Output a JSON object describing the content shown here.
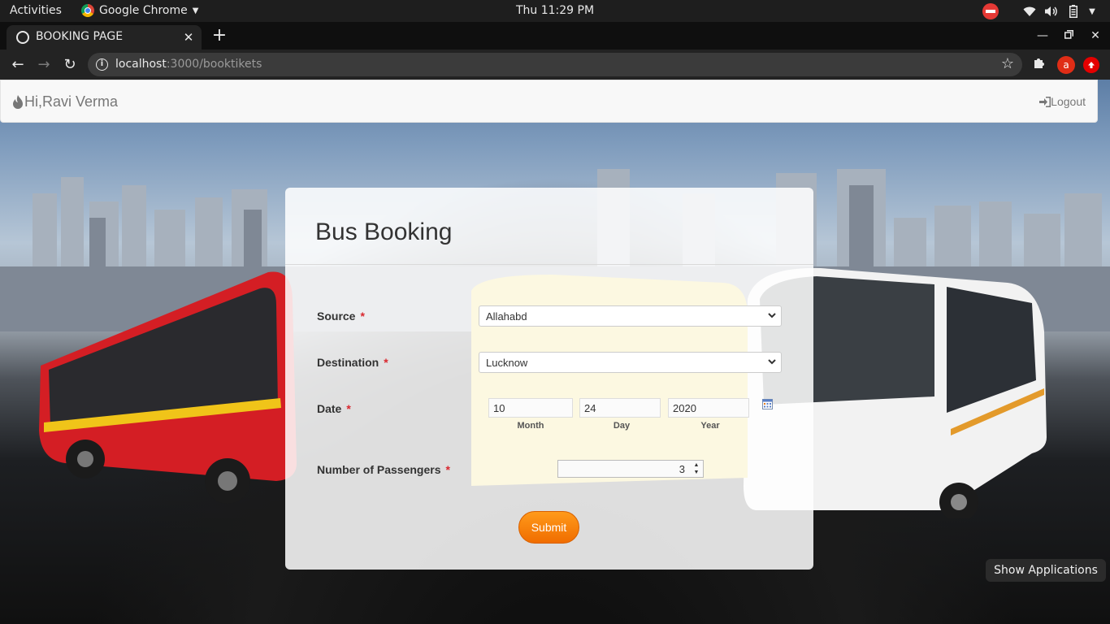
{
  "topbar": {
    "activities": "Activities",
    "app_name": "Google Chrome",
    "clock": "Thu 11:29 PM"
  },
  "browser": {
    "tab_title": "BOOKING PAGE",
    "url_host": "localhost",
    "url_rest": ":3000/booktikets",
    "extension_letter": "a"
  },
  "navbar": {
    "greeting": "Hi,Ravi Verma",
    "logout": "Logout"
  },
  "form": {
    "title": "Bus Booking",
    "source_label": "Source",
    "source_value": "Allahabd",
    "destination_label": "Destination",
    "destination_value": "Lucknow",
    "date_label": "Date",
    "month_value": "10",
    "day_value": "24",
    "year_value": "2020",
    "month_caption": "Month",
    "day_caption": "Day",
    "year_caption": "Year",
    "passengers_label": "Number of Passengers",
    "passengers_value": "3",
    "required_mark": "*",
    "submit_label": "Submit"
  },
  "dock": {
    "tooltip": "Show Applications"
  },
  "colors": {
    "accent_orange": "#f58200",
    "required_red": "#d9272e"
  }
}
